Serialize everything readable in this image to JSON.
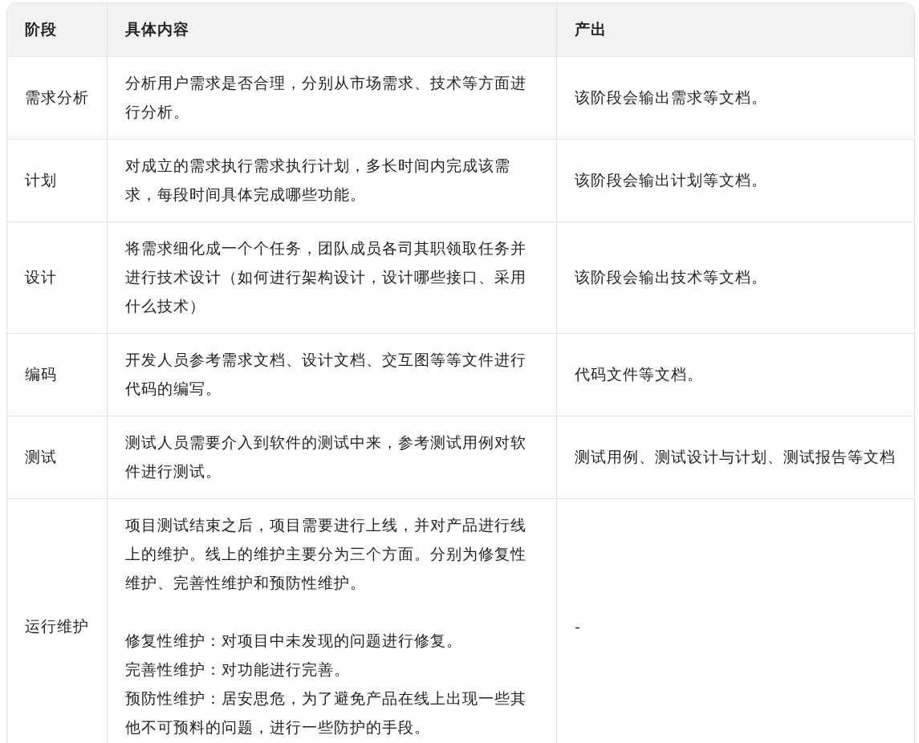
{
  "table": {
    "columns": [
      "阶段",
      "具体内容",
      "产出"
    ],
    "rows": [
      {
        "stage": "需求分析",
        "content": [
          [
            "分析用户需求是否合理，分别从市场需求、技术等方面进行分析。"
          ]
        ],
        "output": "该阶段会输出需求等文档。"
      },
      {
        "stage": "计划",
        "content": [
          [
            "对成立的需求执行需求执行计划，多长时间内完成该需求，每段时间具体完成哪些功能。"
          ]
        ],
        "output": "该阶段会输出计划等文档。"
      },
      {
        "stage": "设计",
        "content": [
          [
            "将需求细化成一个个任务，团队成员各司其职领取任务并进行技术设计（如何进行架构设计，设计哪些接口、采用什么技术）"
          ]
        ],
        "output": "该阶段会输出技术等文档。"
      },
      {
        "stage": "编码",
        "content": [
          [
            "开发人员参考需求文档、设计文档、交互图等等文件进行代码的编写。"
          ]
        ],
        "output": "代码文件等文档。"
      },
      {
        "stage": "测试",
        "content": [
          [
            "测试人员需要介入到软件的测试中来，参考测试用例对软件进行测试。"
          ]
        ],
        "output": "测试用例、测试设计与计划、测试报告等文档"
      },
      {
        "stage": "运行维护",
        "content": [
          [
            "项目测试结束之后，项目需要进行上线，并对产品进行线上的维护。线上的维护主要分为三个方面。分别为修复性维护、完善性维护和预防性维护。"
          ],
          [
            "修复性维护：对项目中未发现的问题进行修复。",
            "完善性维护：对功能进行完善。",
            "预防性维护：居安思危，为了避免产品在线上出现一些其他不可预料的问题，进行一些防护的手段。"
          ]
        ],
        "output": "-"
      }
    ]
  }
}
